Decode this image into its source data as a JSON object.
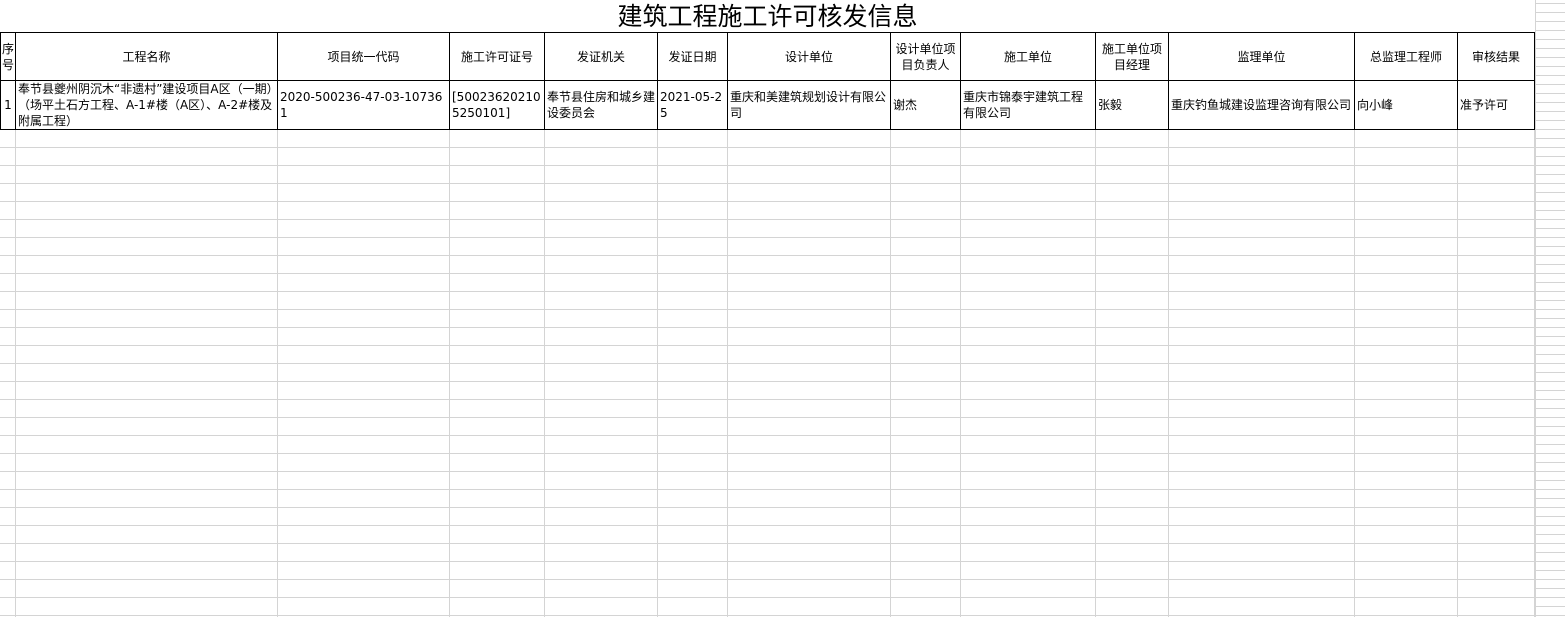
{
  "title": "建筑工程施工许可核发信息",
  "headers": [
    "序号",
    "工程名称",
    "项目统一代码",
    "施工许可证号",
    "发证机关",
    "发证日期",
    "设计单位",
    "设计单位项目负责人",
    "施工单位",
    "施工单位项目经理",
    "监理单位",
    "总监理工程师",
    "审核结果"
  ],
  "rows": [
    {
      "c0": "1",
      "c1": "奉节县夔州阴沉木“非遗村”建设项目A区（一期）（场平土石方工程、A-1#楼（A区）、A-2#楼及附属工程）",
      "c2": "2020-500236-47-03-107361",
      "c3": "[500236202105250101]",
      "c4": "奉节县住房和城乡建设委员会",
      "c5": "2021-05-25",
      "c6": "重庆和美建筑规划设计有限公司",
      "c7": "谢杰",
      "c8": "重庆市锦泰宇建筑工程有限公司",
      "c9": "张毅",
      "c10": "重庆钓鱼城建设监理咨询有限公司",
      "c11": "向小峰",
      "c12": "准予许可"
    }
  ]
}
